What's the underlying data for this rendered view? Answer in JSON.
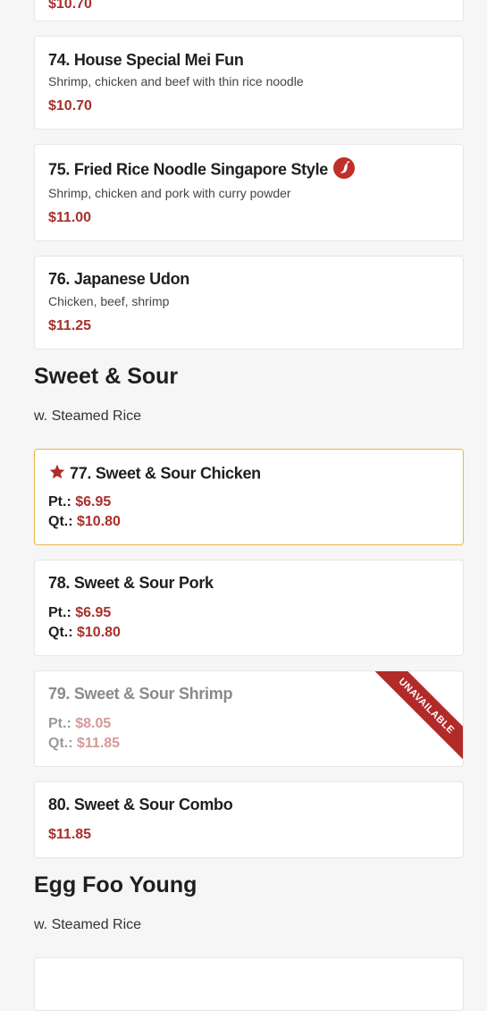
{
  "colors": {
    "accent": "#a8302b",
    "highlight_border": "#e8b64a",
    "ribbon": "#b12b2b"
  },
  "top_card": {
    "price": "$10.70"
  },
  "items_noodle": [
    {
      "title": "74. House Special Mei Fun",
      "desc": "Shrimp, chicken and beef with thin rice noodle",
      "price": "$10.70"
    },
    {
      "title": "75. Fried Rice Noodle Singapore Style",
      "desc": "Shrimp, chicken and pork with curry powder",
      "price": "$11.00",
      "icon": "spicy-icon"
    },
    {
      "title": "76. Japanese Udon",
      "desc": "Chicken, beef, shrimp",
      "price": "$11.25"
    }
  ],
  "sweet_sour": {
    "title": "Sweet & Sour",
    "subtitle": "w. Steamed Rice",
    "items": [
      {
        "title": "77. Sweet & Sour Chicken",
        "pt_label": "Pt.:",
        "pt_price": "$6.95",
        "qt_label": "Qt.:",
        "qt_price": "$10.80",
        "icon": "star-icon"
      },
      {
        "title": "78. Sweet & Sour Pork",
        "pt_label": "Pt.:",
        "pt_price": "$6.95",
        "qt_label": "Qt.:",
        "qt_price": "$10.80"
      },
      {
        "title": "79. Sweet & Sour Shrimp",
        "pt_label": "Pt.:",
        "pt_price": "$8.05",
        "qt_label": "Qt.:",
        "qt_price": "$11.85",
        "badge": "UNAVAILABLE"
      },
      {
        "title": "80. Sweet & Sour Combo",
        "price": "$11.85"
      }
    ]
  },
  "egg_foo_young": {
    "title": "Egg Foo Young",
    "subtitle": "w. Steamed Rice"
  }
}
